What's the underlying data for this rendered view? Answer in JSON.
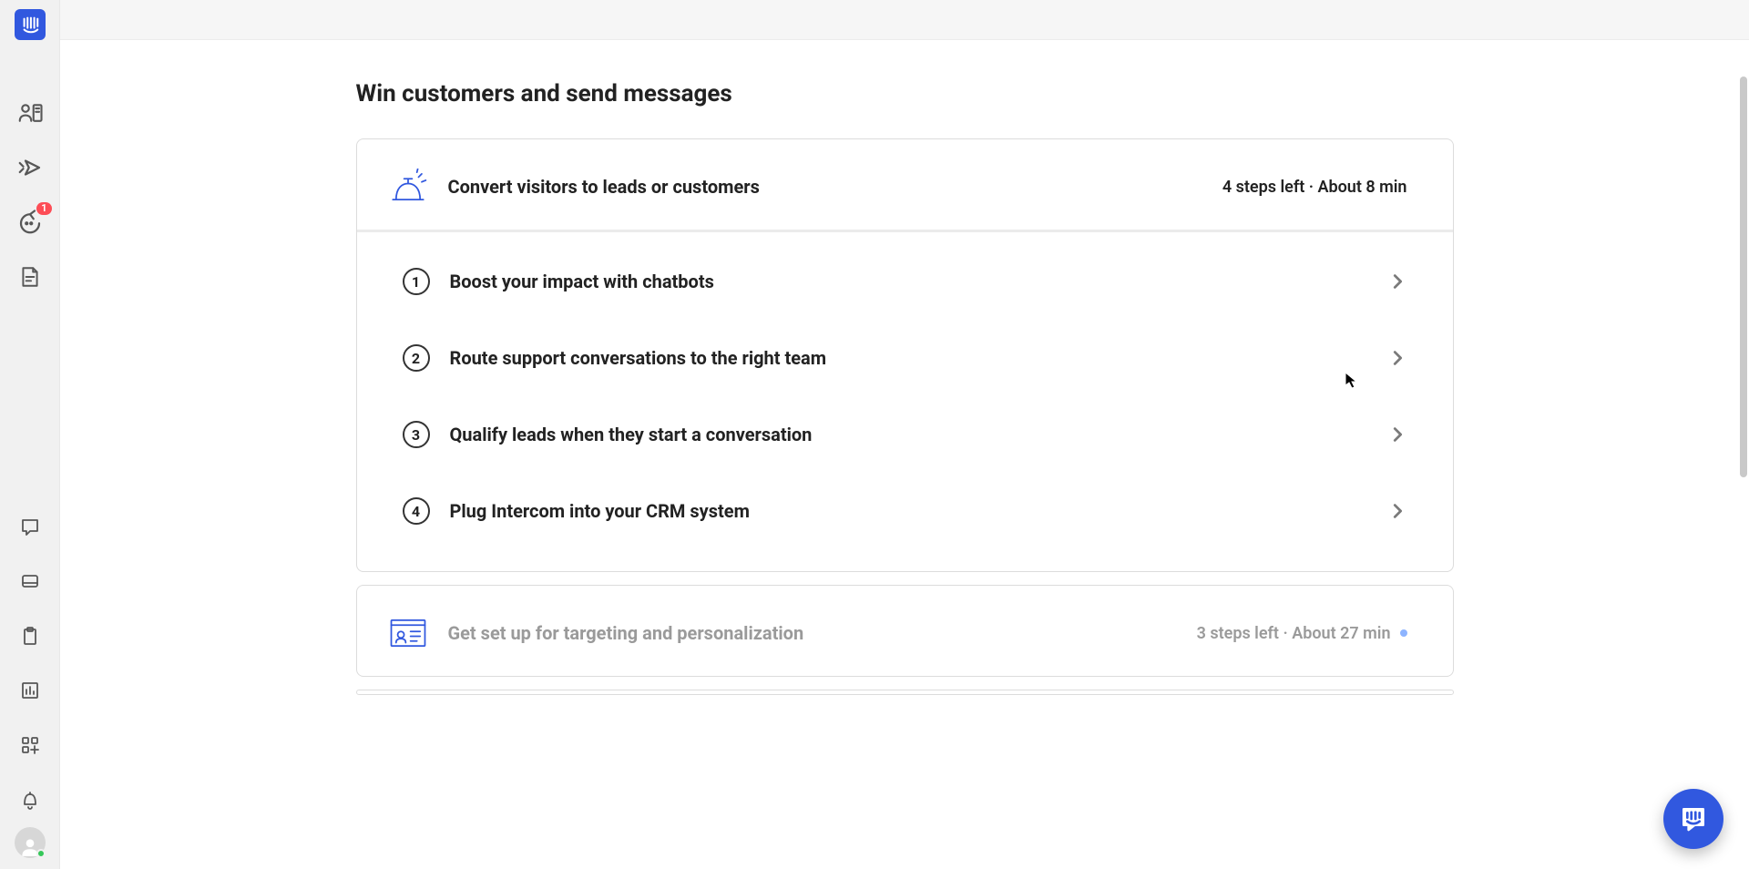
{
  "sidebar": {
    "badge_count": "1"
  },
  "page": {
    "title": "Win customers and send messages"
  },
  "cards": [
    {
      "title": "Convert visitors to leads or customers",
      "meta": "4 steps left · About 8 min",
      "steps": [
        {
          "num": "1",
          "label": "Boost your impact with chatbots"
        },
        {
          "num": "2",
          "label": "Route support conversations to the right team"
        },
        {
          "num": "3",
          "label": "Qualify leads when they start a conversation"
        },
        {
          "num": "4",
          "label": "Plug Intercom into your CRM system"
        }
      ]
    },
    {
      "title": "Get set up for targeting and personalization",
      "meta": "3 steps left · About 27 min"
    }
  ]
}
